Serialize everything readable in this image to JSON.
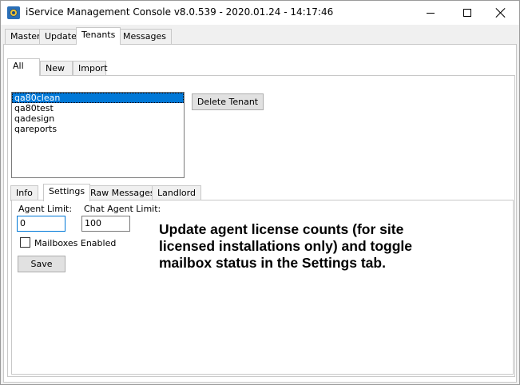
{
  "window": {
    "title": "iService Management Console v8.0.539 - 2020.01.24 - 14:17:46",
    "icon": "gear-app-icon"
  },
  "main_tabs": [
    "Master",
    "Update",
    "Tenants",
    "Messages"
  ],
  "main_active_tab": "Tenants",
  "tenant_tabs": [
    "All",
    "New",
    "Import"
  ],
  "tenant_active_tab": "All",
  "tenants": {
    "items": [
      "qa80clean",
      "qa80test",
      "qadesign",
      "qareports"
    ],
    "selected": "qa80clean",
    "delete_label": "Delete Tenant"
  },
  "detail_tabs": [
    "Info",
    "Settings",
    "Raw Messages",
    "Landlord"
  ],
  "detail_active_tab": "Settings",
  "settings": {
    "agent_limit_label": "Agent Limit:",
    "agent_limit_value": "0",
    "chat_agent_limit_label": "Chat Agent Limit:",
    "chat_agent_limit_value": "100",
    "mailboxes_enabled_label": "Mailboxes Enabled",
    "mailboxes_enabled": false,
    "save_label": "Save"
  },
  "annotation": "Update agent license counts (for site licensed installations only) and toggle mailbox status in the Settings tab."
}
